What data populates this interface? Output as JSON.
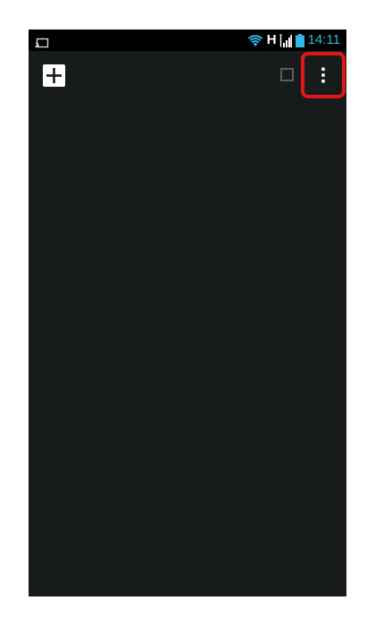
{
  "status_bar": {
    "network_type": "H",
    "time": "14:11",
    "icons": {
      "left": "screen-cast-icon",
      "wifi": "wifi-icon",
      "signal": "signal-strength-icon",
      "battery": "battery-icon"
    }
  },
  "toolbar": {
    "icons": {
      "add": "plus-square-icon",
      "select": "checkbox-icon",
      "menu": "overflow-menu-icon"
    },
    "highlight_color": "#e0161a"
  },
  "colors": {
    "screen_background": "#171b1b",
    "status_bar_background": "#000000",
    "clock": "#33b5e5",
    "wifi": "#33b5e5"
  }
}
